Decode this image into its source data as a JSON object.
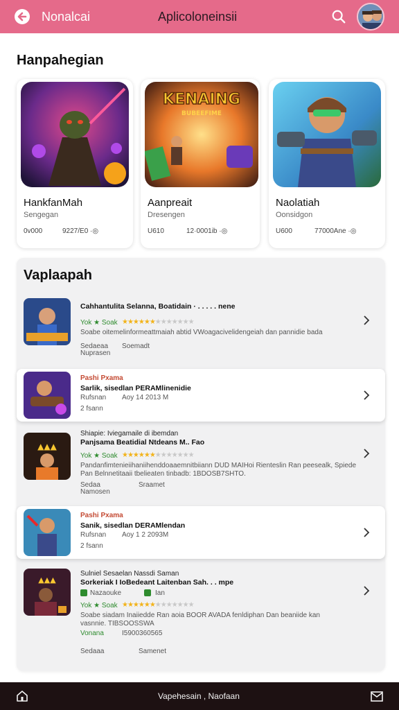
{
  "header": {
    "brand": "Nonalcai",
    "title": "Aplicoloneinsii",
    "bg_color": "#e56a8a"
  },
  "featured": {
    "title": "Hanpahegian",
    "cards": [
      {
        "name": "HankfanMah",
        "sub": "Sengegan",
        "meta1": "0v000",
        "meta2": "9227/E0 ·◎"
      },
      {
        "name": "Aanpreait",
        "sub": "Dresengen",
        "meta1": "U610",
        "meta2": "12·0001ib ·◎"
      },
      {
        "name": "Naolatiah",
        "sub": "Oonsidgon",
        "meta1": "U600",
        "meta2": "77000Ane ·◎"
      }
    ],
    "card2_art_text": "KENAING",
    "card2_art_sub": "BUBEEFIME"
  },
  "list": {
    "title": "Vaplaapah",
    "items": [
      {
        "l1": "Cahhantulita Selanna, Boatidain · . . . . . nene",
        "l2": "Yok ★ Soak",
        "l3": "Soabe oitemelinformeattmaiah abtid VWoagacivelidengeiah dan pannidie bada",
        "l4": "Sedaeaa",
        "l5": "Soemadt",
        "l6": "Nuprasen"
      },
      {
        "l1": "Pashi Pxama",
        "l2": "Sarlik, sisedlan PERAMlinenidie",
        "l3": "Rufsnan",
        "l4": "Aoy 14 2013 M",
        "l5": "2 fsann"
      },
      {
        "l1": "Shiapie: Iviegamaile di ibemdan",
        "l2": "Panjsama Beatidial Ntdeans M.. Fao",
        "l3": "Yok ★ Soak",
        "l4": "Pandanfimtenieiihaniihenddoaaemnitbiiann DUD MAIHoi Rienteslin Ran peesealk, Spiede",
        "l5": "Pan Belnnetitaaii tbelieaten tinbadb: 1BDOSB7SHTO.",
        "l6": "Sedaa",
        "l7": "Sraamet",
        "l8": "Namosen"
      },
      {
        "l1": "Pashi Pxama",
        "l2": "Sanik, sisedlan DERAMlendan",
        "l3": "Rufsnan",
        "l4": "Aoy 1 2 2093M",
        "l5": "2 fsann"
      },
      {
        "l1": "Sulniel Sesaelan Nassdi Saman",
        "l2": "Sorkeriak I IoBedeant Laitenban Sah. . . mpe",
        "l3": "Nazaouke",
        "l4": "Ian",
        "l5": "Yok ★ Soak",
        "l6": "Soabe siadam Inaiiedde Ran aoia BOOR AVADA fenldiphan Dan beaniide kan",
        "l7": "vasnnie. TIBSOOSSWA",
        "l8": "Vonana",
        "l9": "I5900360565",
        "l10": "Sedaaa",
        "l11": "Samenet"
      }
    ]
  },
  "bottombar": {
    "label": "Vapehesain , Naofaan"
  }
}
